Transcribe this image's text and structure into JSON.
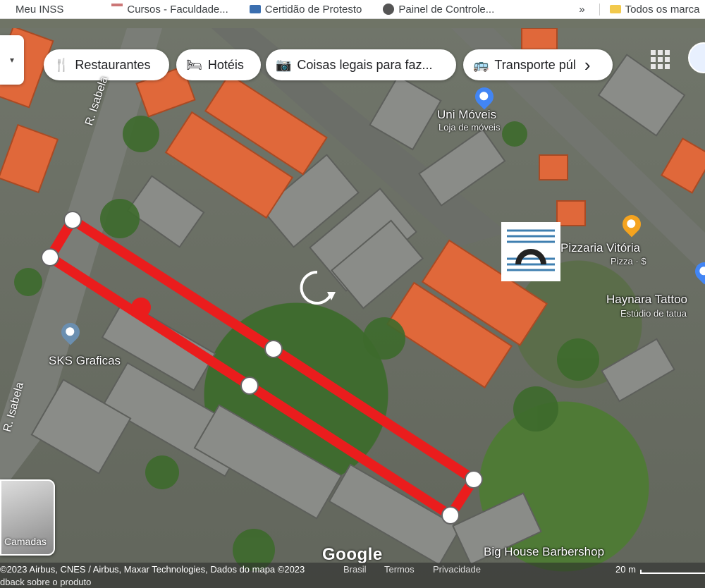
{
  "bookmarks": [
    {
      "label": "Meu INSS",
      "icon": "page-icon"
    },
    {
      "label": "Cursos - Faculdade...",
      "icon": "graduation-cap-icon"
    },
    {
      "label": "Certidão de Protesto",
      "icon": "document-icon"
    },
    {
      "label": "Painel de Controle...",
      "icon": "globe-icon"
    }
  ],
  "bookmarks_overflow": "»",
  "bookmarks_all": "Todos os marca",
  "chips": [
    {
      "label": "Restaurantes",
      "icon": "fork-knife-icon"
    },
    {
      "label": "Hotéis",
      "icon": "bed-icon"
    },
    {
      "label": "Coisas legais para faz...",
      "icon": "camera-icon"
    },
    {
      "label": "Transporte púl",
      "icon": "bus-icon"
    }
  ],
  "chips_next": "›",
  "streets": {
    "top": "R. Isabela",
    "bottom": "R. Isabela"
  },
  "places": [
    {
      "name": "Uni Móveis",
      "subtitle": "Loja de móveis",
      "pin_color": "#4285f4"
    },
    {
      "name": "Pizzaria Vitória",
      "subtitle": "Pizza · $",
      "pin_color": "#f4a31f"
    },
    {
      "name": "Haynara Tattoo",
      "subtitle": "Estúdio de tatua",
      "pin_color": "#4285f4"
    },
    {
      "name": "SKS Graficas",
      "subtitle": "",
      "pin_color": "#6b8fb0"
    },
    {
      "name": "Big House Barbershop",
      "subtitle": "",
      "pin_color": ""
    }
  ],
  "measurement": {
    "line_color": "#ea1d1d",
    "vertex_count": 6
  },
  "layers_label": "Camadas",
  "google_logo": "Google",
  "footer": {
    "copyright": "©2023 Airbus, CNES / Airbus, Maxar Technologies, Dados do mapa ©2023",
    "country": "Brasil",
    "terms": "Termos",
    "privacy": "Privacidade",
    "scale": "20 m",
    "feedback": "dback sobre o produto"
  },
  "colors": {
    "roof": "#e0683a",
    "road": "#777a74",
    "accent_blue": "#4285f4"
  }
}
